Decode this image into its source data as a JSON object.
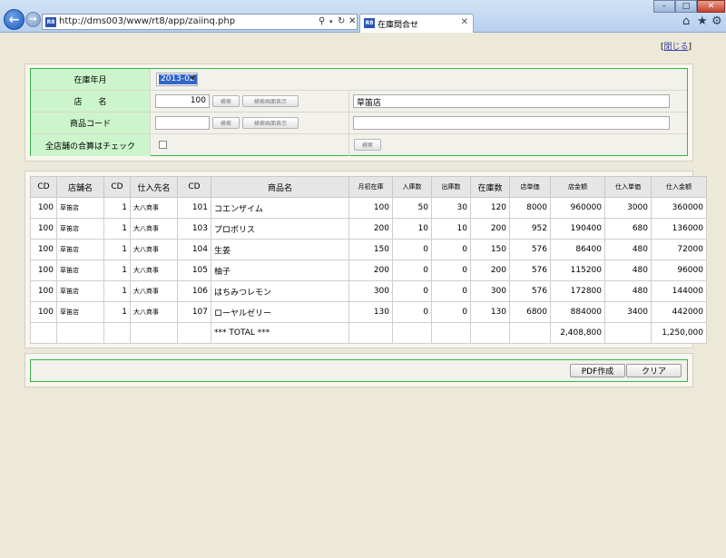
{
  "browser": {
    "url": "http://dms003/www/rt8/app/zaiinq.php",
    "tab_title": "在庫問合せ",
    "favicon_text": "R8",
    "window_buttons": {
      "minimize": "–",
      "maximize": "□",
      "close": "✕"
    },
    "icons": [
      "back-icon",
      "forward-icon",
      "search-icon",
      "refresh-icon",
      "close-icon",
      "home-icon",
      "favorites-star-icon",
      "gear-icon"
    ]
  },
  "page": {
    "close_link_label": "閉じる",
    "close_link_open": "[",
    "close_link_end": "]"
  },
  "form": {
    "year_month_label": "在庫年月",
    "year_month_value": "2013-02",
    "store_label": "店　　名",
    "store_code": "100",
    "store_search_btn": "検索",
    "store_view_btn": "検索画面表示",
    "store_name": "草笛店",
    "product_label": "商品コード",
    "product_code": "",
    "product_search_btn": "検索",
    "product_view_btn": "検索画面表示",
    "product_name": "",
    "all_stores_label": "全店舗の合算はチェック",
    "all_stores_checked": false,
    "search_btn": "検索"
  },
  "table": {
    "columns": [
      "CD",
      "店舗名",
      "CD",
      "仕入先名",
      "CD",
      "商品名",
      "月初在庫",
      "入庫数",
      "出庫数",
      "在庫数",
      "店単価",
      "店金額",
      "仕入単価",
      "仕入金額"
    ],
    "rows": [
      [
        "100",
        "草笛店",
        "1",
        "大八商事",
        "101",
        "コエンザイム",
        "100",
        "50",
        "30",
        "120",
        "8000",
        "960000",
        "3000",
        "360000"
      ],
      [
        "100",
        "草笛店",
        "1",
        "大八商事",
        "103",
        "プロポリス",
        "200",
        "10",
        "10",
        "200",
        "952",
        "190400",
        "680",
        "136000"
      ],
      [
        "100",
        "草笛店",
        "1",
        "大八商事",
        "104",
        "生姜",
        "150",
        "0",
        "0",
        "150",
        "576",
        "86400",
        "480",
        "72000"
      ],
      [
        "100",
        "草笛店",
        "1",
        "大八商事",
        "105",
        "柚子",
        "200",
        "0",
        "0",
        "200",
        "576",
        "115200",
        "480",
        "96000"
      ],
      [
        "100",
        "草笛店",
        "1",
        "大八商事",
        "106",
        "はちみつレモン",
        "300",
        "0",
        "0",
        "300",
        "576",
        "172800",
        "480",
        "144000"
      ],
      [
        "100",
        "草笛店",
        "1",
        "大八商事",
        "107",
        "ローヤルゼリー",
        "130",
        "0",
        "0",
        "130",
        "6800",
        "884000",
        "3400",
        "442000"
      ]
    ],
    "total_row": [
      "",
      "",
      "",
      "",
      "",
      "*** TOTAL ***",
      "",
      "",
      "",
      "",
      "",
      "2,408,800",
      "",
      "1,250,000"
    ]
  },
  "actions": {
    "pdf_label": "PDF作成",
    "clear_label": "クリア"
  },
  "colors": {
    "form_border": "#39b54a",
    "label_bg": "#ccf5cc",
    "header_bg": "#e6e6e6",
    "selected_bg": "#3166c9"
  }
}
